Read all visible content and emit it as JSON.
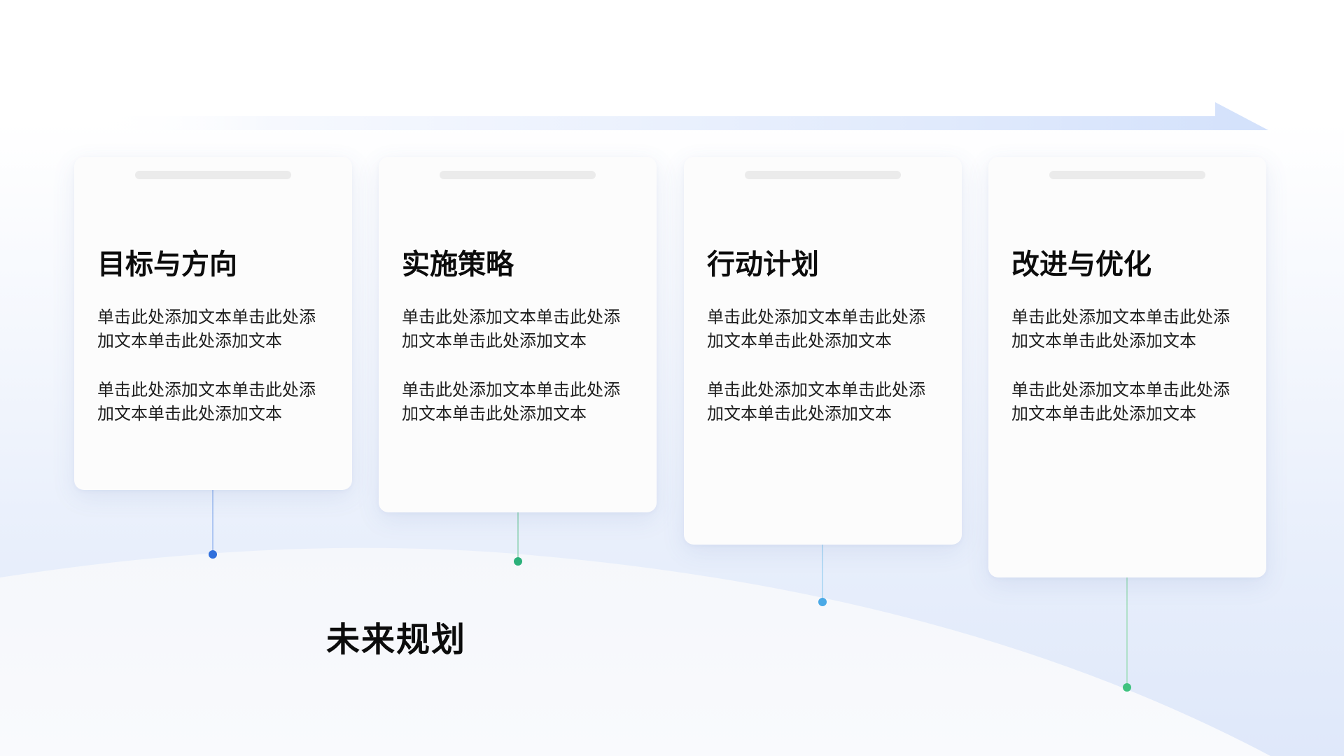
{
  "main_title": "未来规划",
  "colors": {
    "dot_1": "#2f6fdc",
    "dot_2": "#2bb07a",
    "dot_3": "#4aa9e6",
    "dot_4": "#3fc27f",
    "arrow": "#d6e3fb"
  },
  "cards": [
    {
      "title": "目标与方向",
      "paragraphs": [
        "单击此处添加文本单击此处添加文本单击此处添加文本",
        "单击此处添加文本单击此处添加文本单击此处添加文本"
      ]
    },
    {
      "title": "实施策略",
      "paragraphs": [
        "单击此处添加文本单击此处添加文本单击此处添加文本",
        "单击此处添加文本单击此处添加文本单击此处添加文本"
      ]
    },
    {
      "title": "行动计划",
      "paragraphs": [
        "单击此处添加文本单击此处添加文本单击此处添加文本",
        "单击此处添加文本单击此处添加文本单击此处添加文本"
      ]
    },
    {
      "title": "改进与优化",
      "paragraphs": [
        "单击此处添加文本单击此处添加文本单击此处添加文本",
        "单击此处添加文本单击此处添加文本单击此处添加文本"
      ]
    }
  ]
}
